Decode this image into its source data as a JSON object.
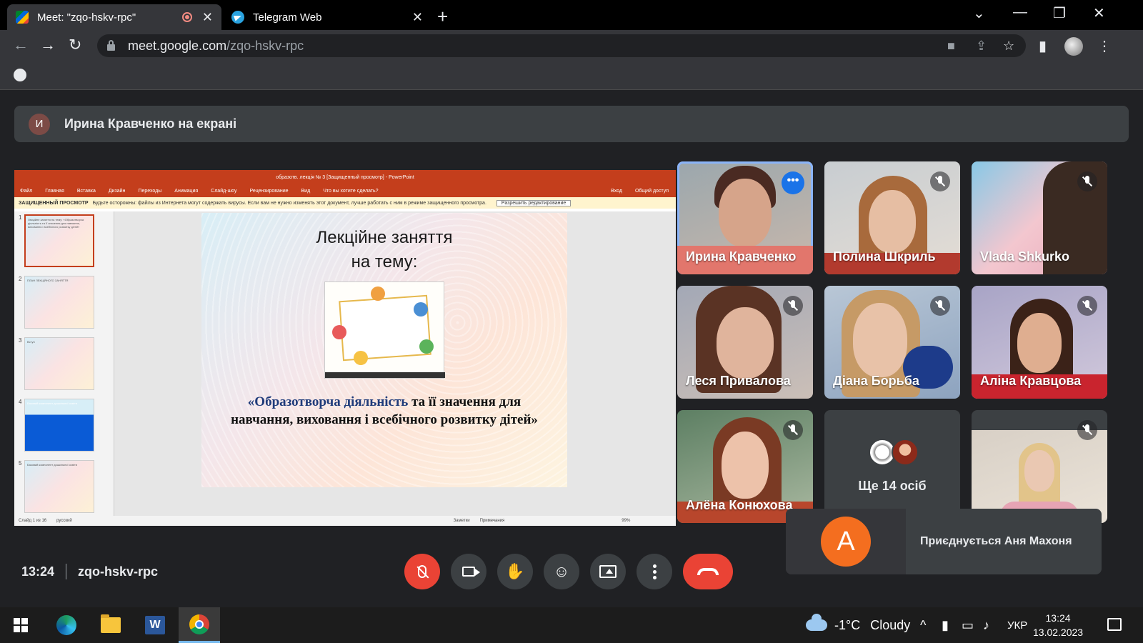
{
  "browser": {
    "tabs": [
      {
        "title": "Meet: \"zqo-hskv-rpc\"",
        "close": "✕"
      },
      {
        "title": "Telegram Web",
        "close": "✕"
      }
    ],
    "new_tab": "+",
    "url_host": "meet.google.com",
    "url_path": "/zqo-hskv-rpc",
    "window_controls": {
      "minimize": "—",
      "restore": "❐",
      "close": "✕",
      "tab_search": "⌄"
    }
  },
  "presenter": {
    "avatar_letter": "И",
    "label": "Ирина Кравченко на екрані"
  },
  "powerpoint": {
    "window_title": "образотв. лекція № 3 [Защищенный просмотр] - PowerPoint",
    "ribbon_tabs": [
      "Файл",
      "Главная",
      "Вставка",
      "Дизайн",
      "Переходы",
      "Анимация",
      "Слайд-шоу",
      "Рецензирование",
      "Вид",
      "Что вы хотите сделать?"
    ],
    "ribbon_right": [
      "Вход",
      "Общий доступ"
    ],
    "protected_label": "ЗАЩИЩЕННЫЙ ПРОСМОТР",
    "protected_text": "Будьте осторожны: файлы из Интернета могут содержать вирусы. Если вам не нужно изменять этот документ, лучше работать с ним в режиме защищенного просмотра.",
    "enable_editing": "Разрешить редактирование",
    "thumbnails": [
      {
        "num": "1",
        "text": "Лекційне заняття на тему: «Образотворча діяльність та її значення для навчання, виховання і всебічного розвитку дітей»"
      },
      {
        "num": "2",
        "text": "ПЛАН ЛЕКЦІЙНОГО ЗАНЯТТЯ"
      },
      {
        "num": "3",
        "text": "Вступ"
      },
      {
        "num": "4",
        "text": "Базовий компонент дошкільної освіти"
      },
      {
        "num": "5",
        "text": "Базовий компонент дошкільної освіти"
      }
    ],
    "slide": {
      "heading_line1": "Лекційне заняття",
      "heading_line2": "на тему:",
      "subtitle_highlight": "«Образотворча діяльність",
      "subtitle_rest": " та її значення для навчання, виховання і всебічного розвитку дітей»"
    },
    "status": {
      "slide_count": "Слайд 1 из 16",
      "language": "русский",
      "notes": "Заметки",
      "comments": "Примечания",
      "zoom": "99%"
    }
  },
  "participants": [
    {
      "name": "Ирина Кравченко",
      "muted": false,
      "active": true
    },
    {
      "name": "Полина Шкриль",
      "muted": true
    },
    {
      "name": "Vlada Shkurko",
      "muted": true
    },
    {
      "name": "Леся Привалова",
      "muted": true
    },
    {
      "name": "Діана Борьба",
      "muted": true
    },
    {
      "name": "Аліна Кравцова",
      "muted": true
    },
    {
      "name": "Алёна Конюхова",
      "muted": true
    },
    {
      "name": "Ще 14 осіб",
      "muted": false
    },
    {
      "name": "",
      "muted": true
    }
  ],
  "toast": {
    "avatar_letter": "A",
    "text": "Приєднується Аня Махоня"
  },
  "meeting": {
    "time": "13:24",
    "code": "zqo-hskv-rpc"
  },
  "controls": {
    "more_dots": "•••"
  },
  "taskbar": {
    "weather_temp": "-1°C",
    "weather_desc": "Cloudy",
    "language": "УКР",
    "time": "13:24",
    "date": "13.02.2023"
  }
}
